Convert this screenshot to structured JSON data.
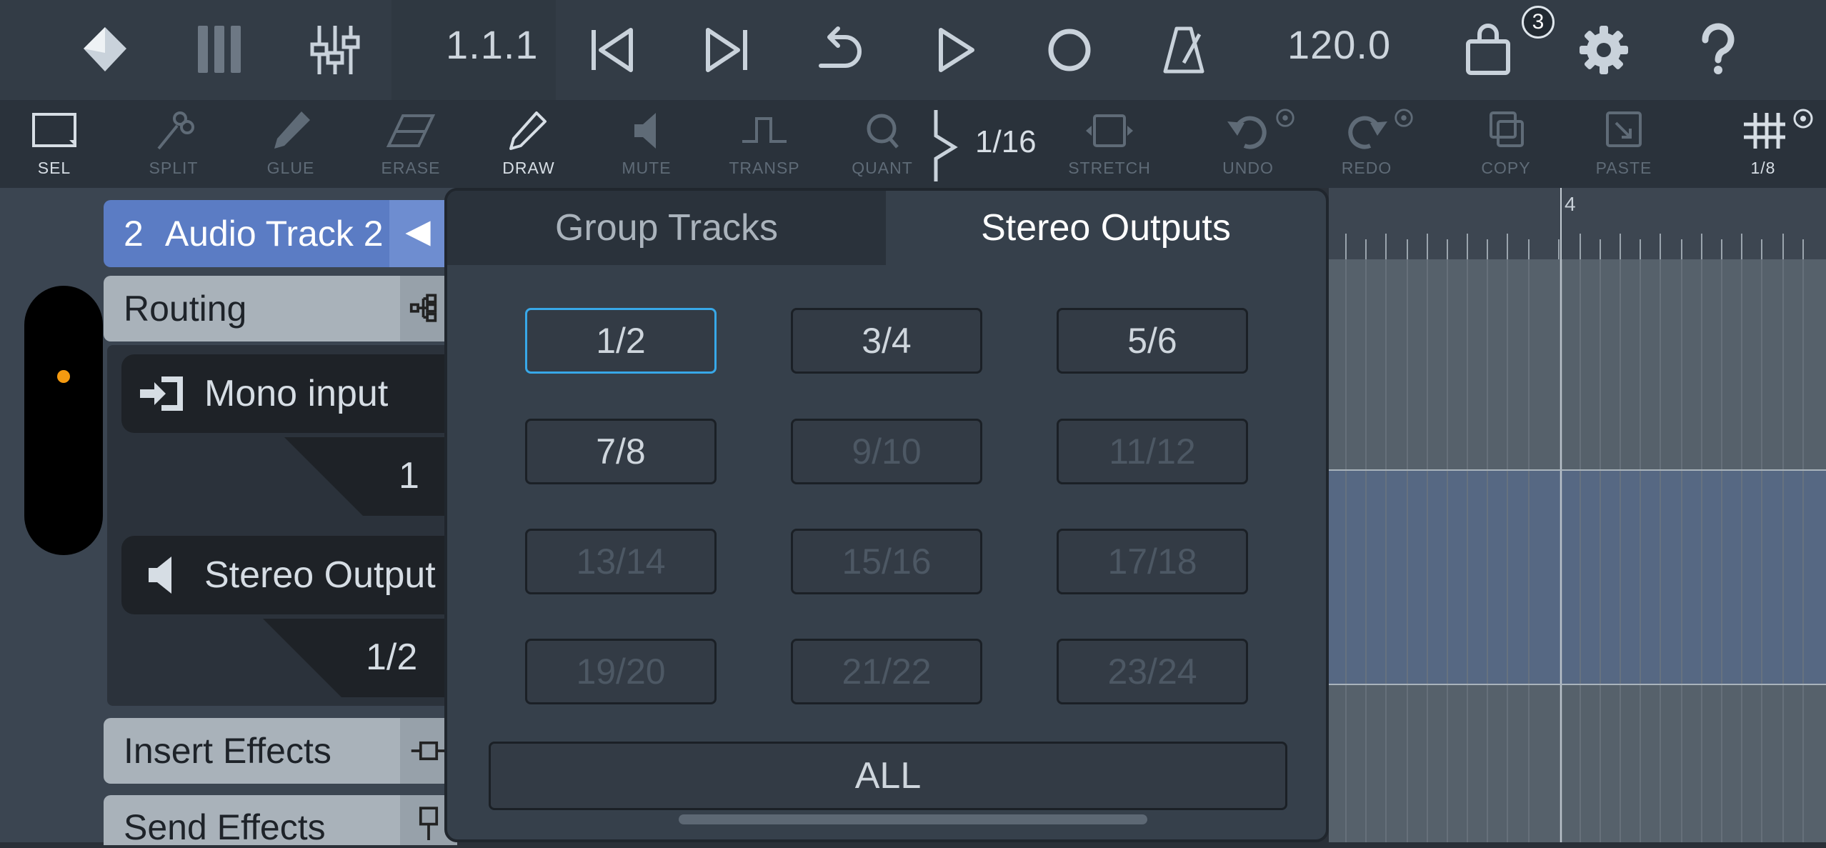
{
  "transport": {
    "position": "1.1.1",
    "tempo": "120.0",
    "shop_badge": "3"
  },
  "tools": [
    {
      "label": "SEL",
      "icon": "select-icon",
      "enabled": true
    },
    {
      "label": "SPLIT",
      "icon": "split-icon",
      "enabled": false
    },
    {
      "label": "GLUE",
      "icon": "glue-icon",
      "enabled": false
    },
    {
      "label": "ERASE",
      "icon": "erase-icon",
      "enabled": false
    },
    {
      "label": "DRAW",
      "icon": "draw-icon",
      "enabled": true
    },
    {
      "label": "MUTE",
      "icon": "mute-icon",
      "enabled": false
    },
    {
      "label": "TRANSP",
      "icon": "transpose-icon",
      "enabled": false
    },
    {
      "label": "QUANT",
      "icon": "quantize-icon",
      "enabled": false
    },
    {
      "label": "STRETCH",
      "icon": "stretch-icon",
      "enabled": false
    },
    {
      "label": "UNDO",
      "icon": "undo-icon",
      "enabled": false
    },
    {
      "label": "REDO",
      "icon": "redo-icon",
      "enabled": false
    },
    {
      "label": "COPY",
      "icon": "copy-icon",
      "enabled": false
    },
    {
      "label": "PASTE",
      "icon": "paste-icon",
      "enabled": false
    },
    {
      "label": "1/8",
      "icon": "grid-icon",
      "enabled": true
    }
  ],
  "quantize_value": "1/16",
  "track": {
    "number": "2",
    "name": "Audio Track 2"
  },
  "routing": {
    "label": "Routing",
    "input_label": "Mono input",
    "input_value": "1",
    "output_label": "Stereo Output",
    "output_value": "1/2"
  },
  "sections": {
    "insert": "Insert Effects",
    "send": "Send Effects"
  },
  "ruler": {
    "bar_marker": "4"
  },
  "popup": {
    "tabs": [
      "Group Tracks",
      "Stereo Outputs"
    ],
    "active_tab": "Stereo Outputs",
    "outputs": [
      {
        "label": "1/2",
        "enabled": true,
        "selected": true
      },
      {
        "label": "3/4",
        "enabled": true,
        "selected": false
      },
      {
        "label": "5/6",
        "enabled": true,
        "selected": false
      },
      {
        "label": "7/8",
        "enabled": true,
        "selected": false
      },
      {
        "label": "9/10",
        "enabled": false,
        "selected": false
      },
      {
        "label": "11/12",
        "enabled": false,
        "selected": false
      },
      {
        "label": "13/14",
        "enabled": false,
        "selected": false
      },
      {
        "label": "15/16",
        "enabled": false,
        "selected": false
      },
      {
        "label": "17/18",
        "enabled": false,
        "selected": false
      },
      {
        "label": "19/20",
        "enabled": false,
        "selected": false
      },
      {
        "label": "21/22",
        "enabled": false,
        "selected": false
      },
      {
        "label": "23/24",
        "enabled": false,
        "selected": false
      }
    ],
    "all_label": "ALL"
  },
  "colors": {
    "accent_blue": "#5b7cc4",
    "selection_border": "#38a8e8",
    "record_dot": "#f59a10"
  }
}
